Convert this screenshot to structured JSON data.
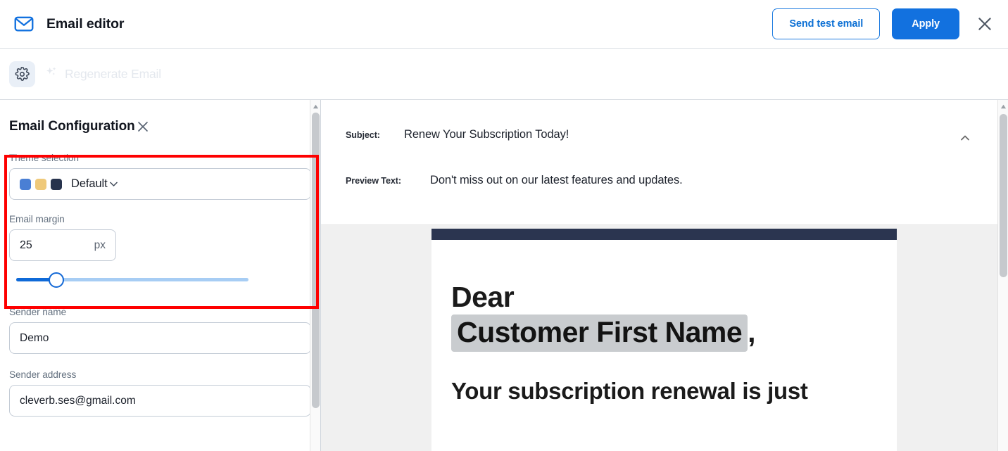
{
  "header": {
    "title": "Email editor",
    "mail_icon": "mail-icon",
    "send_test_label": "Send test email",
    "apply_label": "Apply",
    "close_icon": "close-icon",
    "accent_blue": "#1271df",
    "outline_blue": "#0b6fd4"
  },
  "regenerate_bar": {
    "gear_icon": "gear-icon",
    "sparkle_icon": "sparkle-icon",
    "label": "Regenerate Email",
    "disabled": true
  },
  "config_panel": {
    "title": "Email Configuration",
    "close_icon": "close-icon",
    "theme": {
      "label": "Theme selection",
      "selected": "Default",
      "swatches": [
        "#4a7fd4",
        "#efc97a",
        "#27334d"
      ],
      "chevron_icon": "chevron-down-icon"
    },
    "margin": {
      "label": "Email margin",
      "value": "25",
      "unit": "px",
      "slider_percent": 18
    },
    "sender_name": {
      "label": "Sender name",
      "value": "Demo"
    },
    "sender_address": {
      "label": "Sender address",
      "value": "cleverb.ses@gmail.com"
    },
    "highlight_color": "#fe0000"
  },
  "preview": {
    "subject_label": "Subject:",
    "subject_value": "Renew Your Subscription Today!",
    "preview_label": "Preview Text:",
    "preview_value": "Don't miss out on our latest features and updates.",
    "collapse_icon": "chevron-up-icon",
    "email": {
      "accent_bar_color": "#2b3550",
      "greeting": "Dear",
      "merge_tag": "Customer First Name",
      "greeting_comma": ",",
      "paragraph": "Your subscription renewal is just"
    }
  }
}
